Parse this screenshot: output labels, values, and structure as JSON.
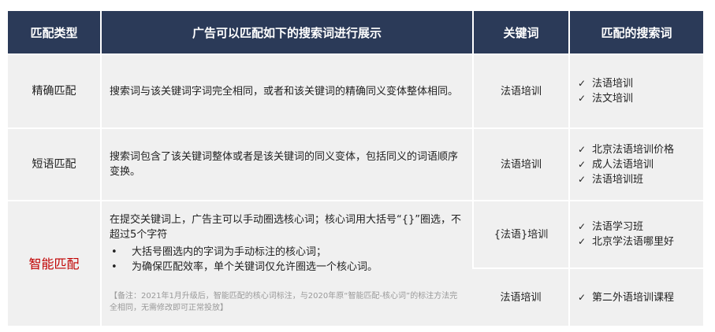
{
  "header": {
    "col1": "匹配类型",
    "col2": "广告可以匹配如下的搜索词进行展示",
    "col3": "关键词",
    "col4": "匹配的搜索词"
  },
  "check_icon": "✓",
  "bullet_icon": "•",
  "rows": {
    "exact": {
      "type": "精确匹配",
      "desc": "搜索词与该关键词字词完全相同，或者和该关键词的精确同义变体整体相同。",
      "keyword": "法语培训",
      "matches": [
        "法语培训",
        "法文培训"
      ]
    },
    "phrase": {
      "type": "短语匹配",
      "desc": "搜索词包含了该关键词整体或者是该关键词的同义变体，包括同义的词语顺序变换。",
      "keyword": "法语培训",
      "matches": [
        "北京法语培训价格",
        "成人法语培训",
        "法语培训班"
      ]
    },
    "smart": {
      "type": "智能匹配",
      "type_color": "#c00000",
      "desc": "在提交关键词上，广告主可以手动圈选核心词；核心词用大括号“{}”圈选，不超过5个字符",
      "bullets": [
        "大括号圈选内的字词为手动标注的核心词；",
        "为确保匹配效率，单个关键词仅允许圈选一个核心词。"
      ],
      "note": "【备注：2021年1月升级后，智能匹配的核心词标注，与2020年原“智能匹配-核心词”的标注方法完全相同，无需修改即可正常投放】",
      "keyword_a": "{法语}培训",
      "matches_a": [
        "法语学习班",
        "北京学法语哪里好"
      ],
      "keyword_b": "法语培训",
      "matches_b": [
        "第二外语培训课程"
      ]
    }
  },
  "colors": {
    "header_bg": "#2b3a58",
    "cell_bg": "#f0f0f0",
    "accent_red": "#c00000",
    "note_gray": "#999999"
  }
}
